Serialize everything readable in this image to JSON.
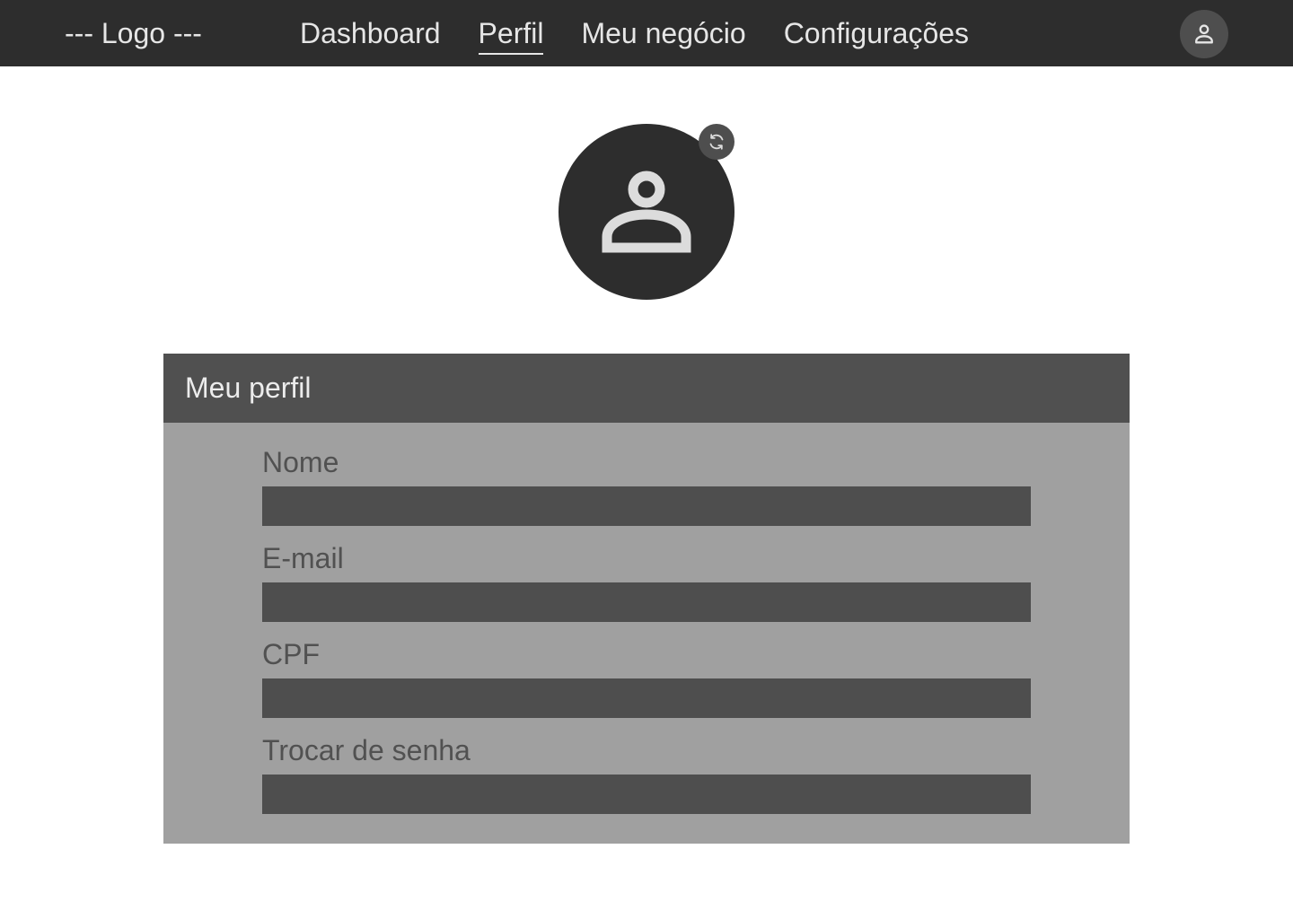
{
  "header": {
    "logo": "--- Logo ---",
    "nav": [
      {
        "label": "Dashboard",
        "active": false
      },
      {
        "label": "Perfil",
        "active": true
      },
      {
        "label": "Meu negócio",
        "active": false
      },
      {
        "label": "Configurações",
        "active": false
      }
    ],
    "account_icon": "person-icon"
  },
  "profile_photo": {
    "icon": "person-icon",
    "change_icon": "refresh-icon"
  },
  "profile_card": {
    "title": "Meu perfil",
    "fields": [
      {
        "label": "Nome",
        "value": ""
      },
      {
        "label": "E-mail",
        "value": ""
      },
      {
        "label": "CPF",
        "value": ""
      },
      {
        "label": "Trocar de senha",
        "value": ""
      }
    ]
  },
  "colors": {
    "topbar": "#2d2d2d",
    "card_header": "#505050",
    "card_body": "#a0a0a0",
    "input": "#4e4e4e"
  }
}
